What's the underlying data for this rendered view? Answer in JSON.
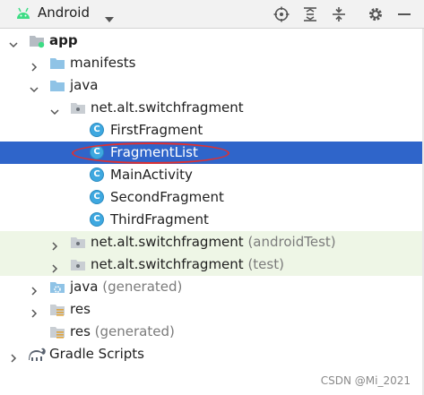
{
  "toolbar": {
    "title": "Android",
    "icons": [
      "android-icon",
      "dropdown-caret-icon",
      "locate-icon",
      "expand-all-icon",
      "collapse-all-icon",
      "gear-icon",
      "hide-icon"
    ]
  },
  "tree": {
    "app": "app",
    "manifests": "manifests",
    "java": "java",
    "package_main": "net.alt.switchfragment",
    "first_fragment": "FirstFragment",
    "fragment_list": "FragmentList",
    "main_activity": "MainActivity",
    "second_fragment": "SecondFragment",
    "third_fragment": "ThirdFragment",
    "package_android_test": "net.alt.switchfragment",
    "android_test_suffix": "(androidTest)",
    "package_test": "net.alt.switchfragment",
    "test_suffix": "(test)",
    "java_generated": "java",
    "java_generated_suffix": "(generated)",
    "res": "res",
    "res_generated": "res",
    "res_generated_suffix": "(generated)",
    "gradle_scripts": "Gradle Scripts"
  },
  "class_badge": "C",
  "colors": {
    "selection": "#2f65ca",
    "test_tint": "#eef6e6",
    "android_green": "#3ddc84",
    "class_icon": "#3ea8e0",
    "folder": "#8fc3e6",
    "annotation": "#e03030"
  },
  "watermark": "CSDN @Mi_2021"
}
